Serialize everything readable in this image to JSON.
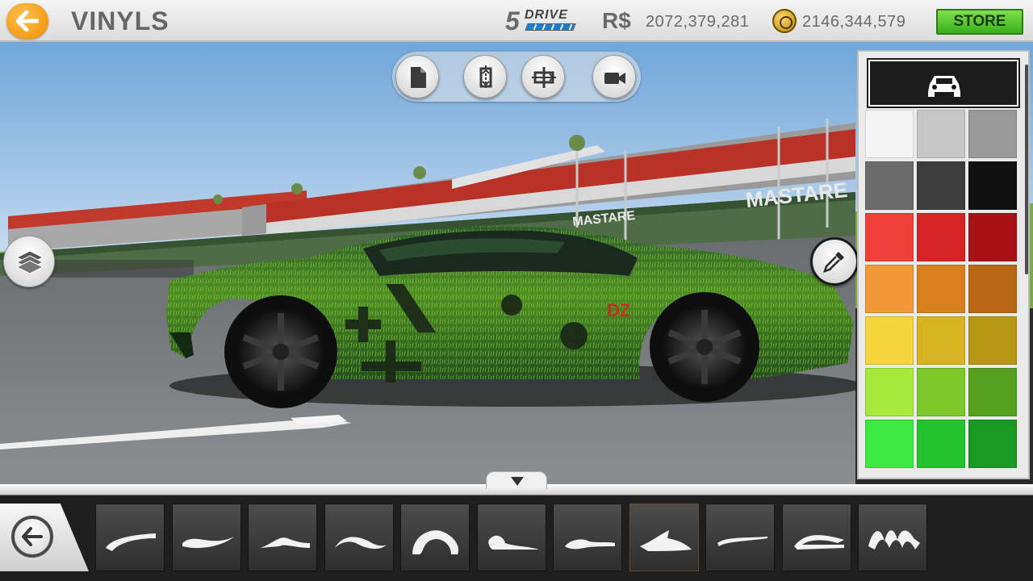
{
  "header": {
    "title": "VINYLS",
    "drive_number": "5",
    "drive_word": "DRIVE",
    "currency_label": "R$",
    "currency_value": "2072,379,281",
    "gold_value": "2146,344,579",
    "store_label": "STORE"
  },
  "scene": {
    "signs": [
      "MASTARE",
      "MASTARE"
    ],
    "car_decal_text": "DZ"
  },
  "toolbar": {
    "buttons": [
      "new-file-icon",
      "flip-horizontal-icon",
      "flip-vertical-icon",
      "camera-icon"
    ]
  },
  "palette": {
    "header_icon": "car-icon",
    "swatches": [
      [
        "#f4f4f4",
        "#c6c6c6",
        "#9a9a9a"
      ],
      [
        "#6b6b6b",
        "#3c3c3c",
        "#101010"
      ],
      [
        "#f0403a",
        "#d62323",
        "#a81414"
      ],
      [
        "#f29a38",
        "#d9801e",
        "#b86714"
      ],
      [
        "#f5d43c",
        "#d8b424",
        "#b89616"
      ],
      [
        "#a8e83c",
        "#7cc82a",
        "#55a01e"
      ],
      [
        "#3ee842",
        "#25c230",
        "#1a9a24"
      ]
    ]
  },
  "strokes": {
    "count": 11,
    "selected_index": 7
  },
  "colors": {
    "accent_orange": "#f08c00",
    "store_green": "#3cae1e",
    "car_green": "#3d7a1e"
  }
}
